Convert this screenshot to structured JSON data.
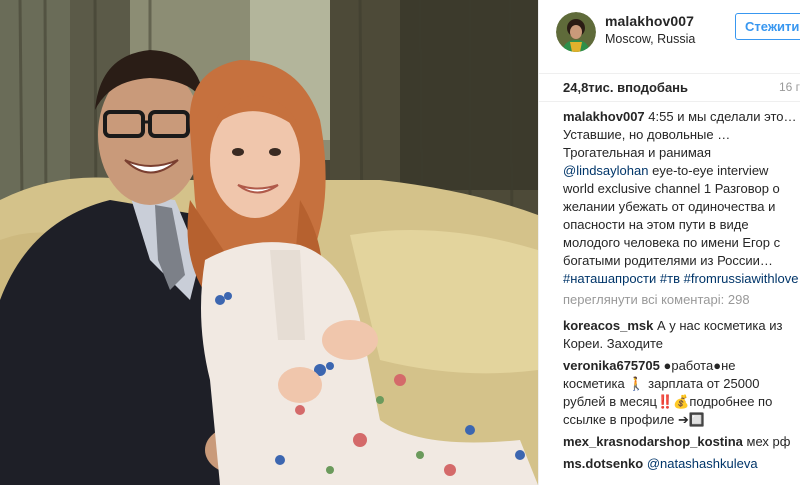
{
  "header": {
    "username": "malakhov007",
    "location": "Moscow, Russia",
    "follow_label": "Стежити"
  },
  "stats": {
    "likes": "24,8тис. вподобань",
    "time": "16 г"
  },
  "caption": {
    "username": "malakhov007",
    "text_1": "4:55 и мы сделали это… Уставшие, но довольные …Трогательная и ранимая",
    "mention": "@lindsaylohan",
    "text_2": "eye-to-eye interview world exclusive channel 1 Разговор о желании убежать от одиночества и опасности на этом пути в виде молодого человека по имени Егор с богатыми родителями из России…",
    "hashtag_1": "#наташапрости",
    "hashtag_2": "#тв",
    "hashtag_3": "#fromrussiawithlove"
  },
  "load_more": "переглянути всі коментарі: 298",
  "comments": [
    {
      "username": "koreacos_msk",
      "text": "А у нас косметика из Кореи. Заходите"
    },
    {
      "username": "veronika675705",
      "text": "●работа●не косметика 🚶 зарплата от 25000 рублей в месяц‼️💰подробнее по ссылке в профиле ➔🔲"
    },
    {
      "username": "mex_krasnodarshop_kostina",
      "text": "мех рф"
    },
    {
      "username": "ms.dotsenko",
      "mention": "@natashashkuleva"
    }
  ],
  "colors": {
    "link": "#003569",
    "follow": "#3897f0",
    "muted": "#999999",
    "text": "#262626"
  },
  "icons": {
    "avatar": "user-avatar-photo"
  }
}
